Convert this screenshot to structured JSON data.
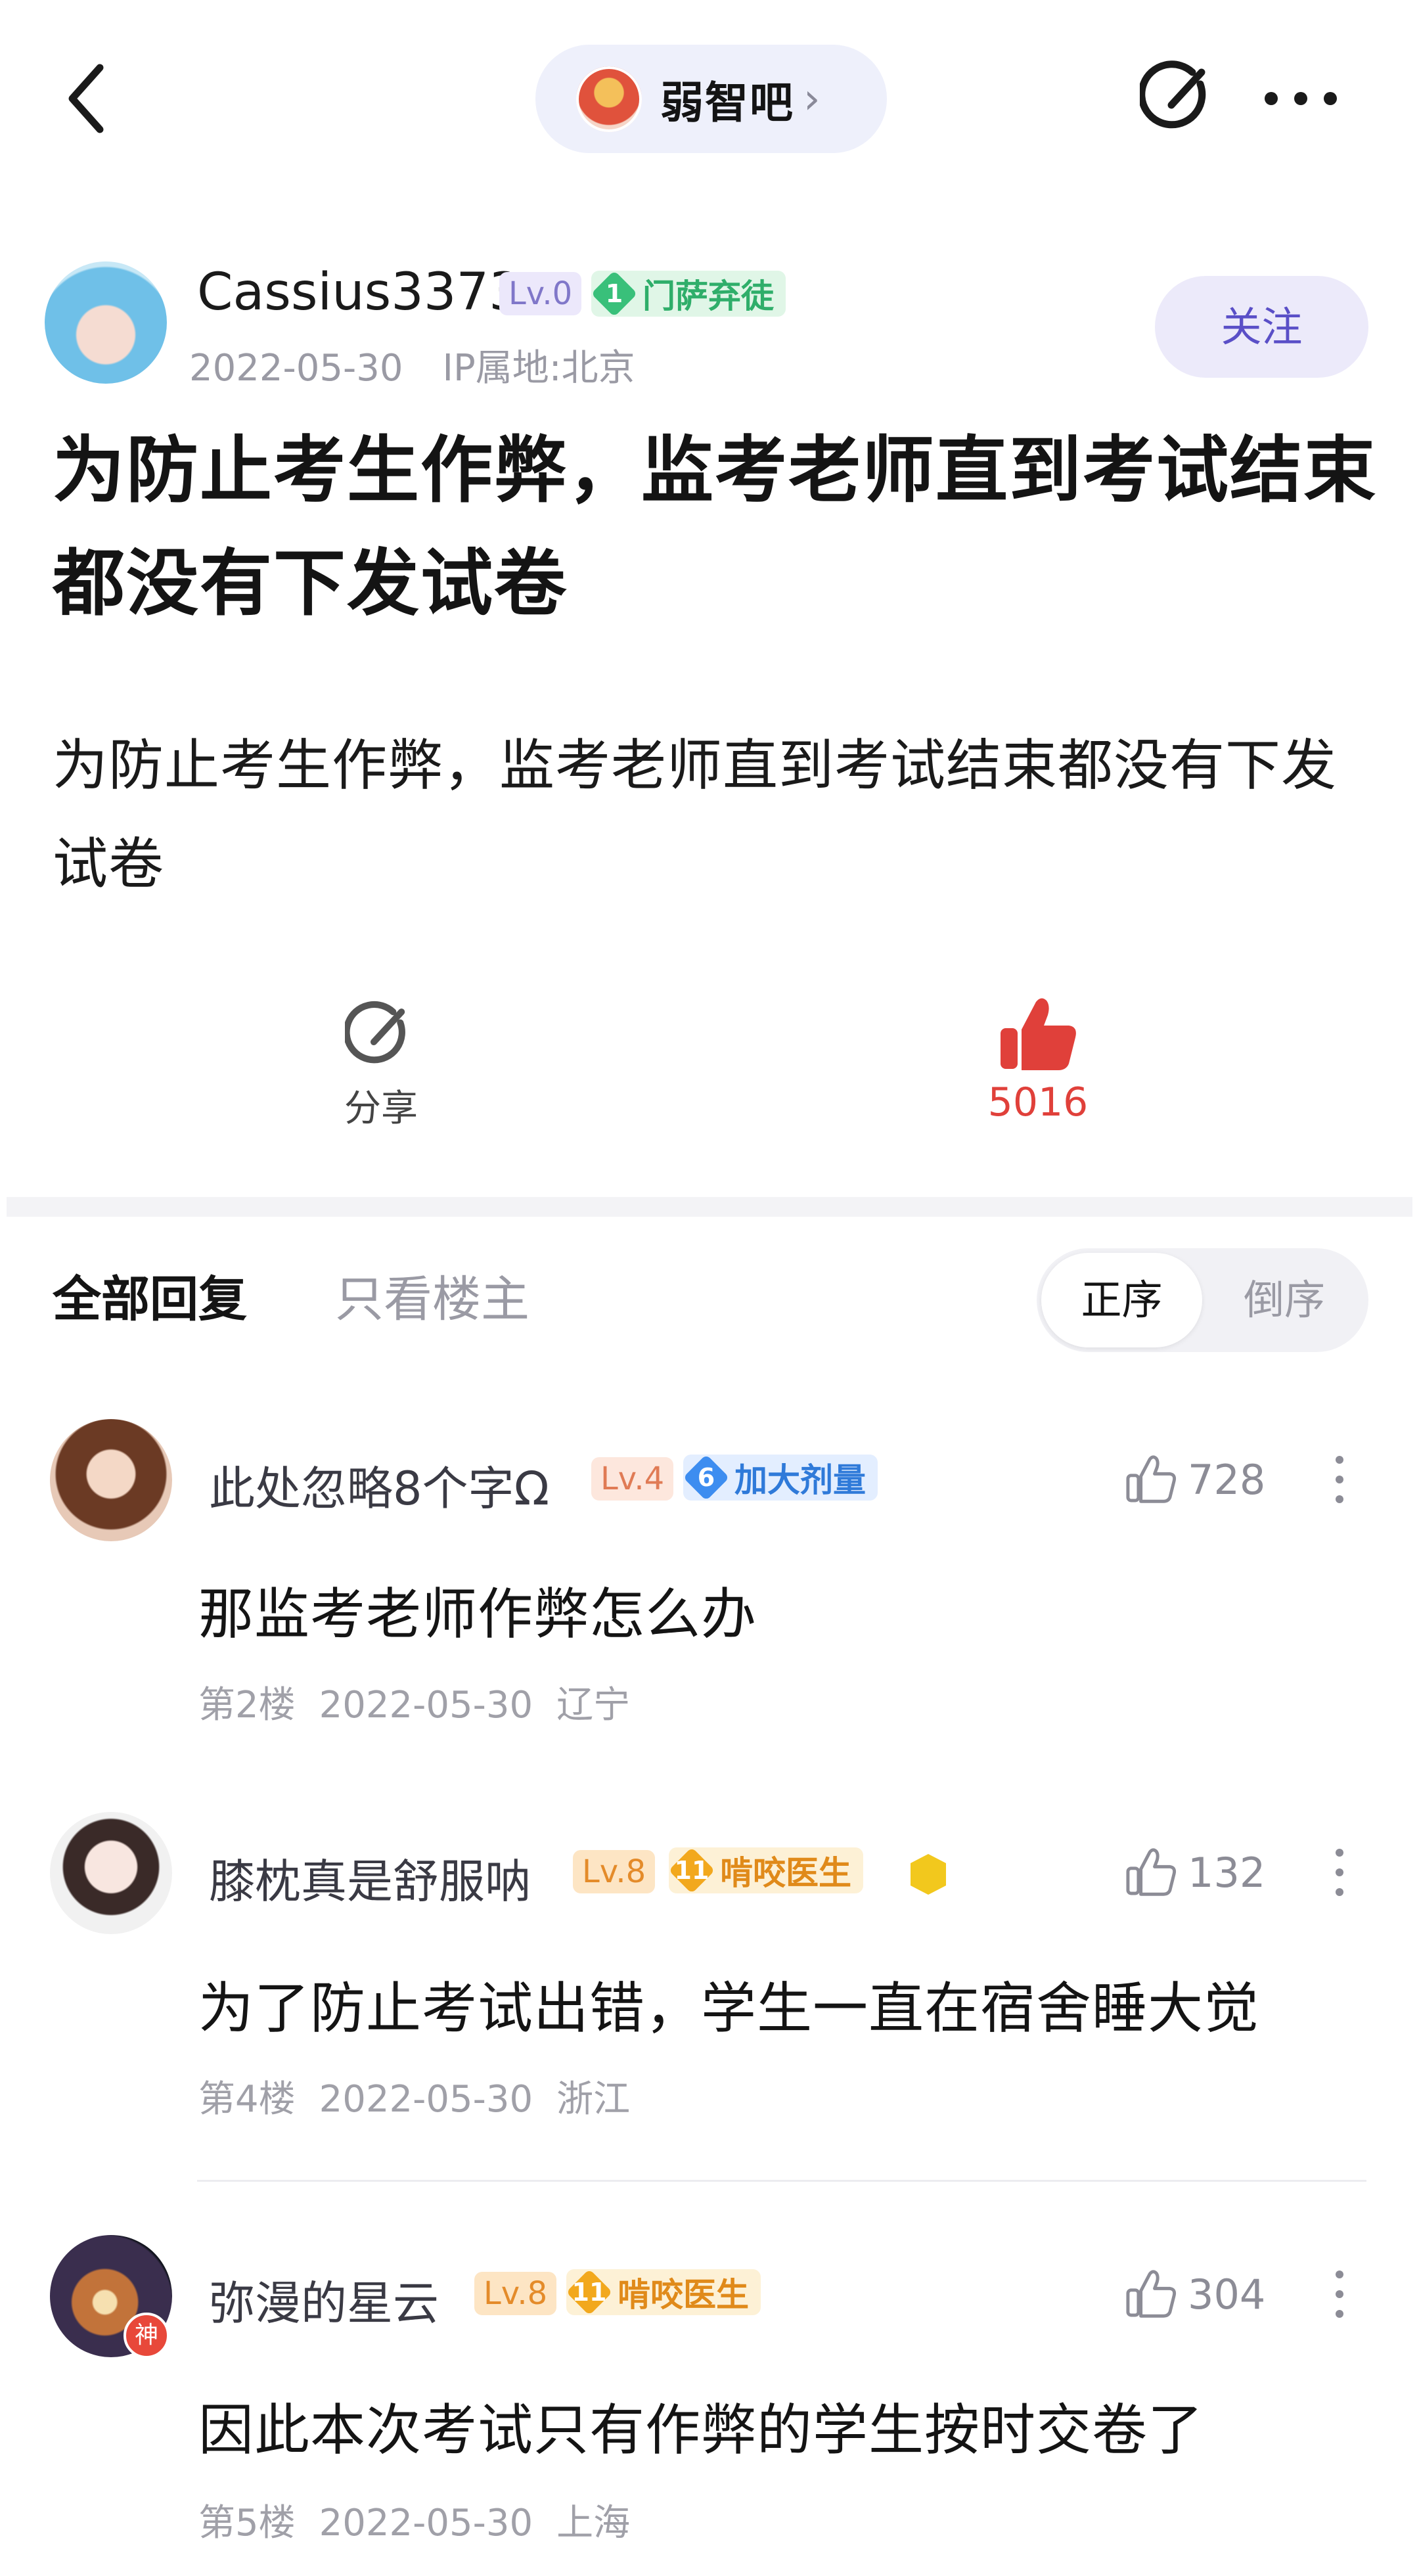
{
  "header": {
    "back_icon": "chevron-left-icon",
    "forum_name": "弱智吧",
    "forum_chevron": "›",
    "share_icon": "share-edit-icon",
    "more_icon": "more-dots-icon"
  },
  "post": {
    "author": {
      "name": "Cassius3373",
      "level": "Lv.0",
      "badge_number": "1",
      "badge_title": "门萨弃徒",
      "date": "2022-05-30",
      "ip": "IP属地:北京",
      "follow_label": "关注"
    },
    "title": "为防止考生作弊，监考老师直到考试结束都没有下发试卷",
    "body": "为防止考生作弊，监考老师直到考试结束都没有下发试卷",
    "share_label": "分享",
    "like_count": "5016",
    "colors": {
      "like": "#e0403a",
      "accent": "#5a4fc7"
    }
  },
  "tabs": {
    "all": "全部回复",
    "host_only": "只看楼主",
    "sort_asc": "正序",
    "sort_desc": "倒序"
  },
  "comments": [
    {
      "name": "此处忽略8个字Ω",
      "level": "Lv.4",
      "badge_number": "6",
      "badge_title": "加大剂量",
      "text": "那监考老师作弊怎么办",
      "floor": "第2楼",
      "date": "2022-05-30",
      "location": "辽宁",
      "likes": "728"
    },
    {
      "name": "膝枕真是舒服呐",
      "level": "Lv.8",
      "badge_number": "11",
      "badge_title": "啃咬医生",
      "text": "为了防止考试出错，学生一直在宿舍睡大觉",
      "floor": "第4楼",
      "date": "2022-05-30",
      "location": "浙江",
      "likes": "132"
    },
    {
      "name": "弥漫的星云",
      "level": "Lv.8",
      "badge_number": "11",
      "badge_title": "啃咬医生",
      "god_tag": "神",
      "text": "因此本次考试只有作弊的学生按时交卷了",
      "floor": "第5楼",
      "date": "2022-05-30",
      "location": "上海",
      "likes": "304"
    }
  ]
}
